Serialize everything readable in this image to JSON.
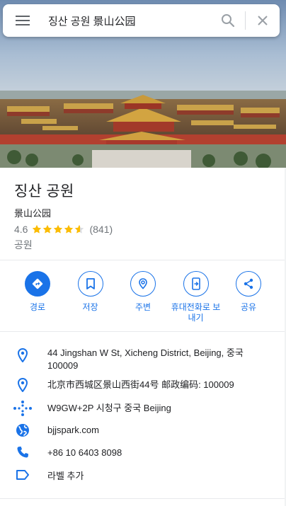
{
  "search": {
    "query": "징산 공원 景山公园",
    "menu_icon": "menu-icon",
    "search_icon": "search-icon",
    "close_icon": "close-icon"
  },
  "hero": {
    "image": "Forbidden City rooftops seen from Jingshan Park"
  },
  "place": {
    "title": "징산 공원",
    "subtitle": "景山公园",
    "rating": "4.6",
    "stars": 4.6,
    "review_count": "(841)",
    "category": "공원"
  },
  "actions": [
    {
      "label": "경로",
      "icon": "directions-icon"
    },
    {
      "label": "저장",
      "icon": "bookmark-icon"
    },
    {
      "label": "주변",
      "icon": "nearby-icon"
    },
    {
      "label": "휴대전화로 보내기",
      "icon": "send-to-phone-icon"
    },
    {
      "label": "공유",
      "icon": "share-icon"
    }
  ],
  "info": {
    "address": "44 Jingshan W St, Xicheng District, Beijing, 중국 100009",
    "address_local": "北京市西城区景山西街44号 邮政编码: 100009",
    "plus_code": "W9GW+2P 시청구 중국 Beijing",
    "website": "bjjspark.com",
    "phone": "+86 10 6403 8098",
    "add_label": "라벨 추가"
  },
  "colors": {
    "accent": "#1a73e8",
    "star": "#fbbc04",
    "secondary_text": "#70757a"
  }
}
